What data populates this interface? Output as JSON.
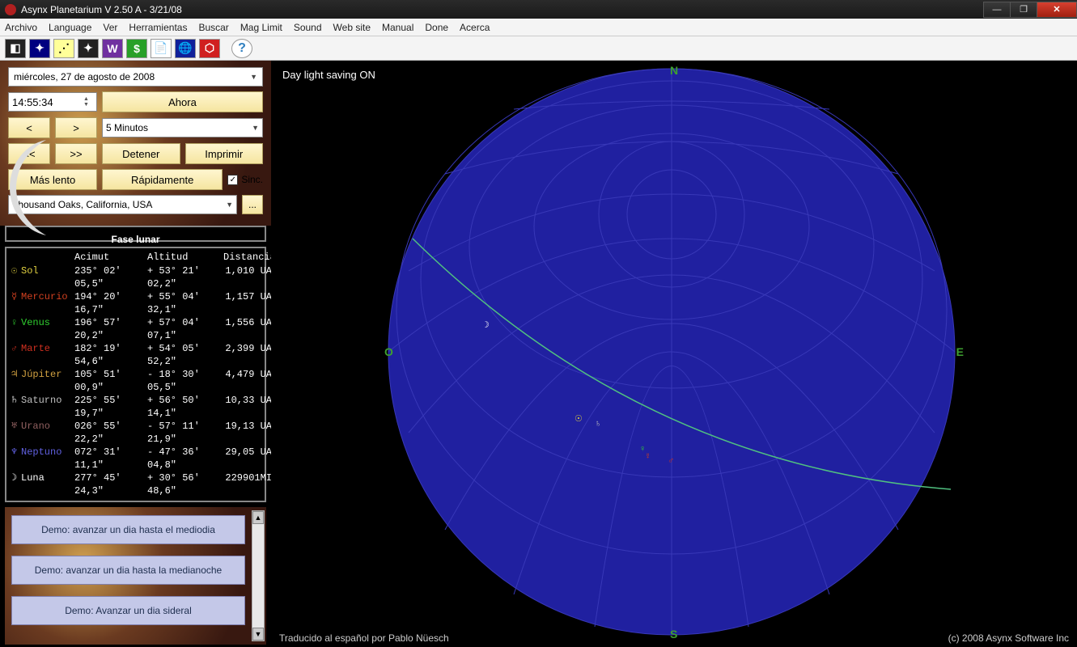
{
  "window": {
    "title": "Asynx Planetarium V 2.50 A - 3/21/08"
  },
  "menu": [
    "Archivo",
    "Language",
    "Ver",
    "Herramientas",
    "Buscar",
    "Mag Limit",
    "Sound",
    "Web site",
    "Manual",
    "Done",
    "Acerca"
  ],
  "controls": {
    "date": "miércoles, 27 de    agosto     de 2008",
    "time": "14:55:34",
    "now": "Ahora",
    "back": "<",
    "fwd": ">",
    "step": "5 Minutos",
    "fback": "<<",
    "ffwd": ">>",
    "stop": "Detener",
    "print": "Imprimir",
    "slower": "Más lento",
    "faster": "Rápidamente",
    "sync": "Sinc.",
    "location": "Thousand Oaks, California, USA",
    "more": "..."
  },
  "moon": {
    "label": "Fase lunar"
  },
  "planet_headers": {
    "az": "Acimut",
    "alt": "Altitud",
    "dist": "Distancia"
  },
  "planets": [
    {
      "sym": "☉",
      "name": "Sol",
      "color": "#e0d040",
      "az": "235° 02' 05,5\"",
      "alt": "+ 53° 21' 02,2\"",
      "dist": "1,010 UA"
    },
    {
      "sym": "☿",
      "name": "Mercurio",
      "color": "#d04020",
      "az": "194° 20' 16,7\"",
      "alt": "+ 55° 04' 32,1\"",
      "dist": "1,157 UA"
    },
    {
      "sym": "♀",
      "name": "Venus",
      "color": "#30d030",
      "az": "196° 57' 20,2\"",
      "alt": "+ 57° 04' 07,1\"",
      "dist": "1,556 UA"
    },
    {
      "sym": "♂",
      "name": "Marte",
      "color": "#d03020",
      "az": "182° 19' 54,6\"",
      "alt": "+ 54° 05' 52,2\"",
      "dist": "2,399 UA"
    },
    {
      "sym": "♃",
      "name": "Júpiter",
      "color": "#d0a040",
      "az": "105° 51' 00,9\"",
      "alt": "-  18° 30' 05,5\"",
      "dist": "4,479 UA"
    },
    {
      "sym": "♄",
      "name": "Saturno",
      "color": "#c0c0c0",
      "az": "225° 55' 19,7\"",
      "alt": "+ 56° 50' 14,1\"",
      "dist": "10,33 UA"
    },
    {
      "sym": "♅",
      "name": "Urano",
      "color": "#906060",
      "az": "026° 55' 22,2\"",
      "alt": "-  57° 11' 21,9\"",
      "dist": "19,13 UA"
    },
    {
      "sym": "♆",
      "name": "Neptuno",
      "color": "#6060e0",
      "az": "072° 31' 11,1\"",
      "alt": "-  47° 36' 04,8\"",
      "dist": "29,05 UA"
    },
    {
      "sym": "☽",
      "name": "Luna",
      "color": "#ffffff",
      "az": "277° 45' 24,3\"",
      "alt": "+ 30° 56' 48,6\"",
      "dist": "229901MI"
    }
  ],
  "demos": [
    "Demo: avanzar un dia hasta el mediodia",
    "Demo: avanzar un dia hasta la medianoche",
    "Demo: Avanzar un dia sideral"
  ],
  "sky": {
    "daylight": "Day light saving ON",
    "n": "N",
    "s": "S",
    "e": "E",
    "o": "O"
  },
  "footer": {
    "left": "Traducido al español por Pablo Nüesch",
    "right": "(c) 2008 Asynx Software Inc"
  }
}
